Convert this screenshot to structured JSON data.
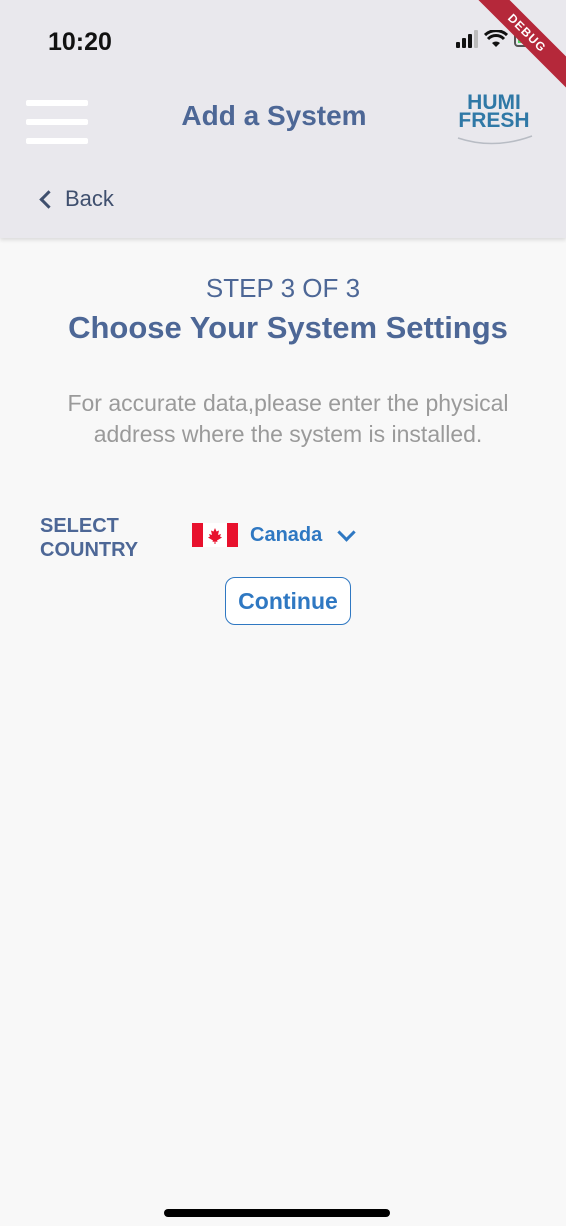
{
  "status_bar": {
    "time": "10:20",
    "debug_label": "DEBUG"
  },
  "nav": {
    "title": "Add a System",
    "back_label": "Back",
    "logo_line1": "HUMI",
    "logo_line2": "FRESH"
  },
  "step": {
    "label": "STEP 3 OF 3",
    "title": "Choose Your System Settings",
    "description": "For accurate data,please enter the physical address where the system is installed."
  },
  "country": {
    "label": "SELECT COUNTRY",
    "selected": "Canada"
  },
  "actions": {
    "continue_label": "Continue"
  },
  "colors": {
    "header_bg": "#e9e8ed",
    "accent_blue": "#2f78c2",
    "title_blue": "#4d6796",
    "debug_red": "#b5283a"
  }
}
